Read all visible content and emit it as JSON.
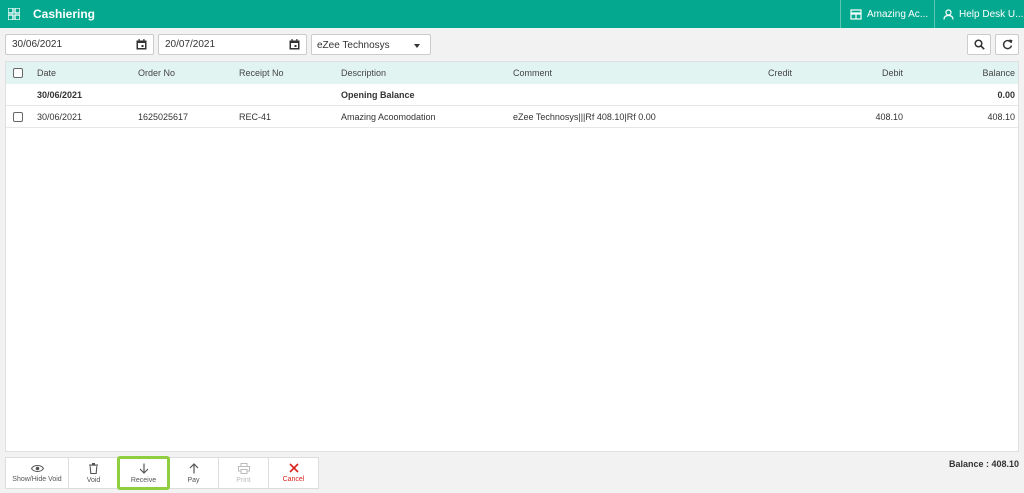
{
  "header": {
    "title": "Cashiering",
    "hotel": "Amazing Ac...",
    "user": "Help Desk U..."
  },
  "filters": {
    "from_date": "30/06/2021",
    "to_date": "20/07/2021",
    "account": "eZee Technosys"
  },
  "table": {
    "columns": [
      "Date",
      "Order No",
      "Receipt No",
      "Description",
      "Comment",
      "Credit",
      "Debit",
      "Balance"
    ],
    "opening": {
      "date": "30/06/2021",
      "description": "Opening Balance",
      "balance": "0.00"
    },
    "rows": [
      {
        "date": "30/06/2021",
        "order_no": "1625025617",
        "receipt_no": "REC-41",
        "description": "Amazing Acoomodation",
        "comment": "eZee Technosys|||Rf 408.10|Rf 0.00",
        "credit": "",
        "debit": "408.10",
        "balance": "408.10"
      }
    ]
  },
  "toolbar": {
    "show_hide_void": "Show/Hide Void",
    "void": "Void",
    "receive": "Receive",
    "pay": "Pay",
    "print": "Print",
    "cancel": "Cancel"
  },
  "footer": {
    "balance": "Balance : 408.10"
  },
  "colors": {
    "brand": "#04a88e",
    "header_row": "#e2f4f1",
    "highlight": "#8fce3e",
    "cancel": "#d9231d"
  }
}
